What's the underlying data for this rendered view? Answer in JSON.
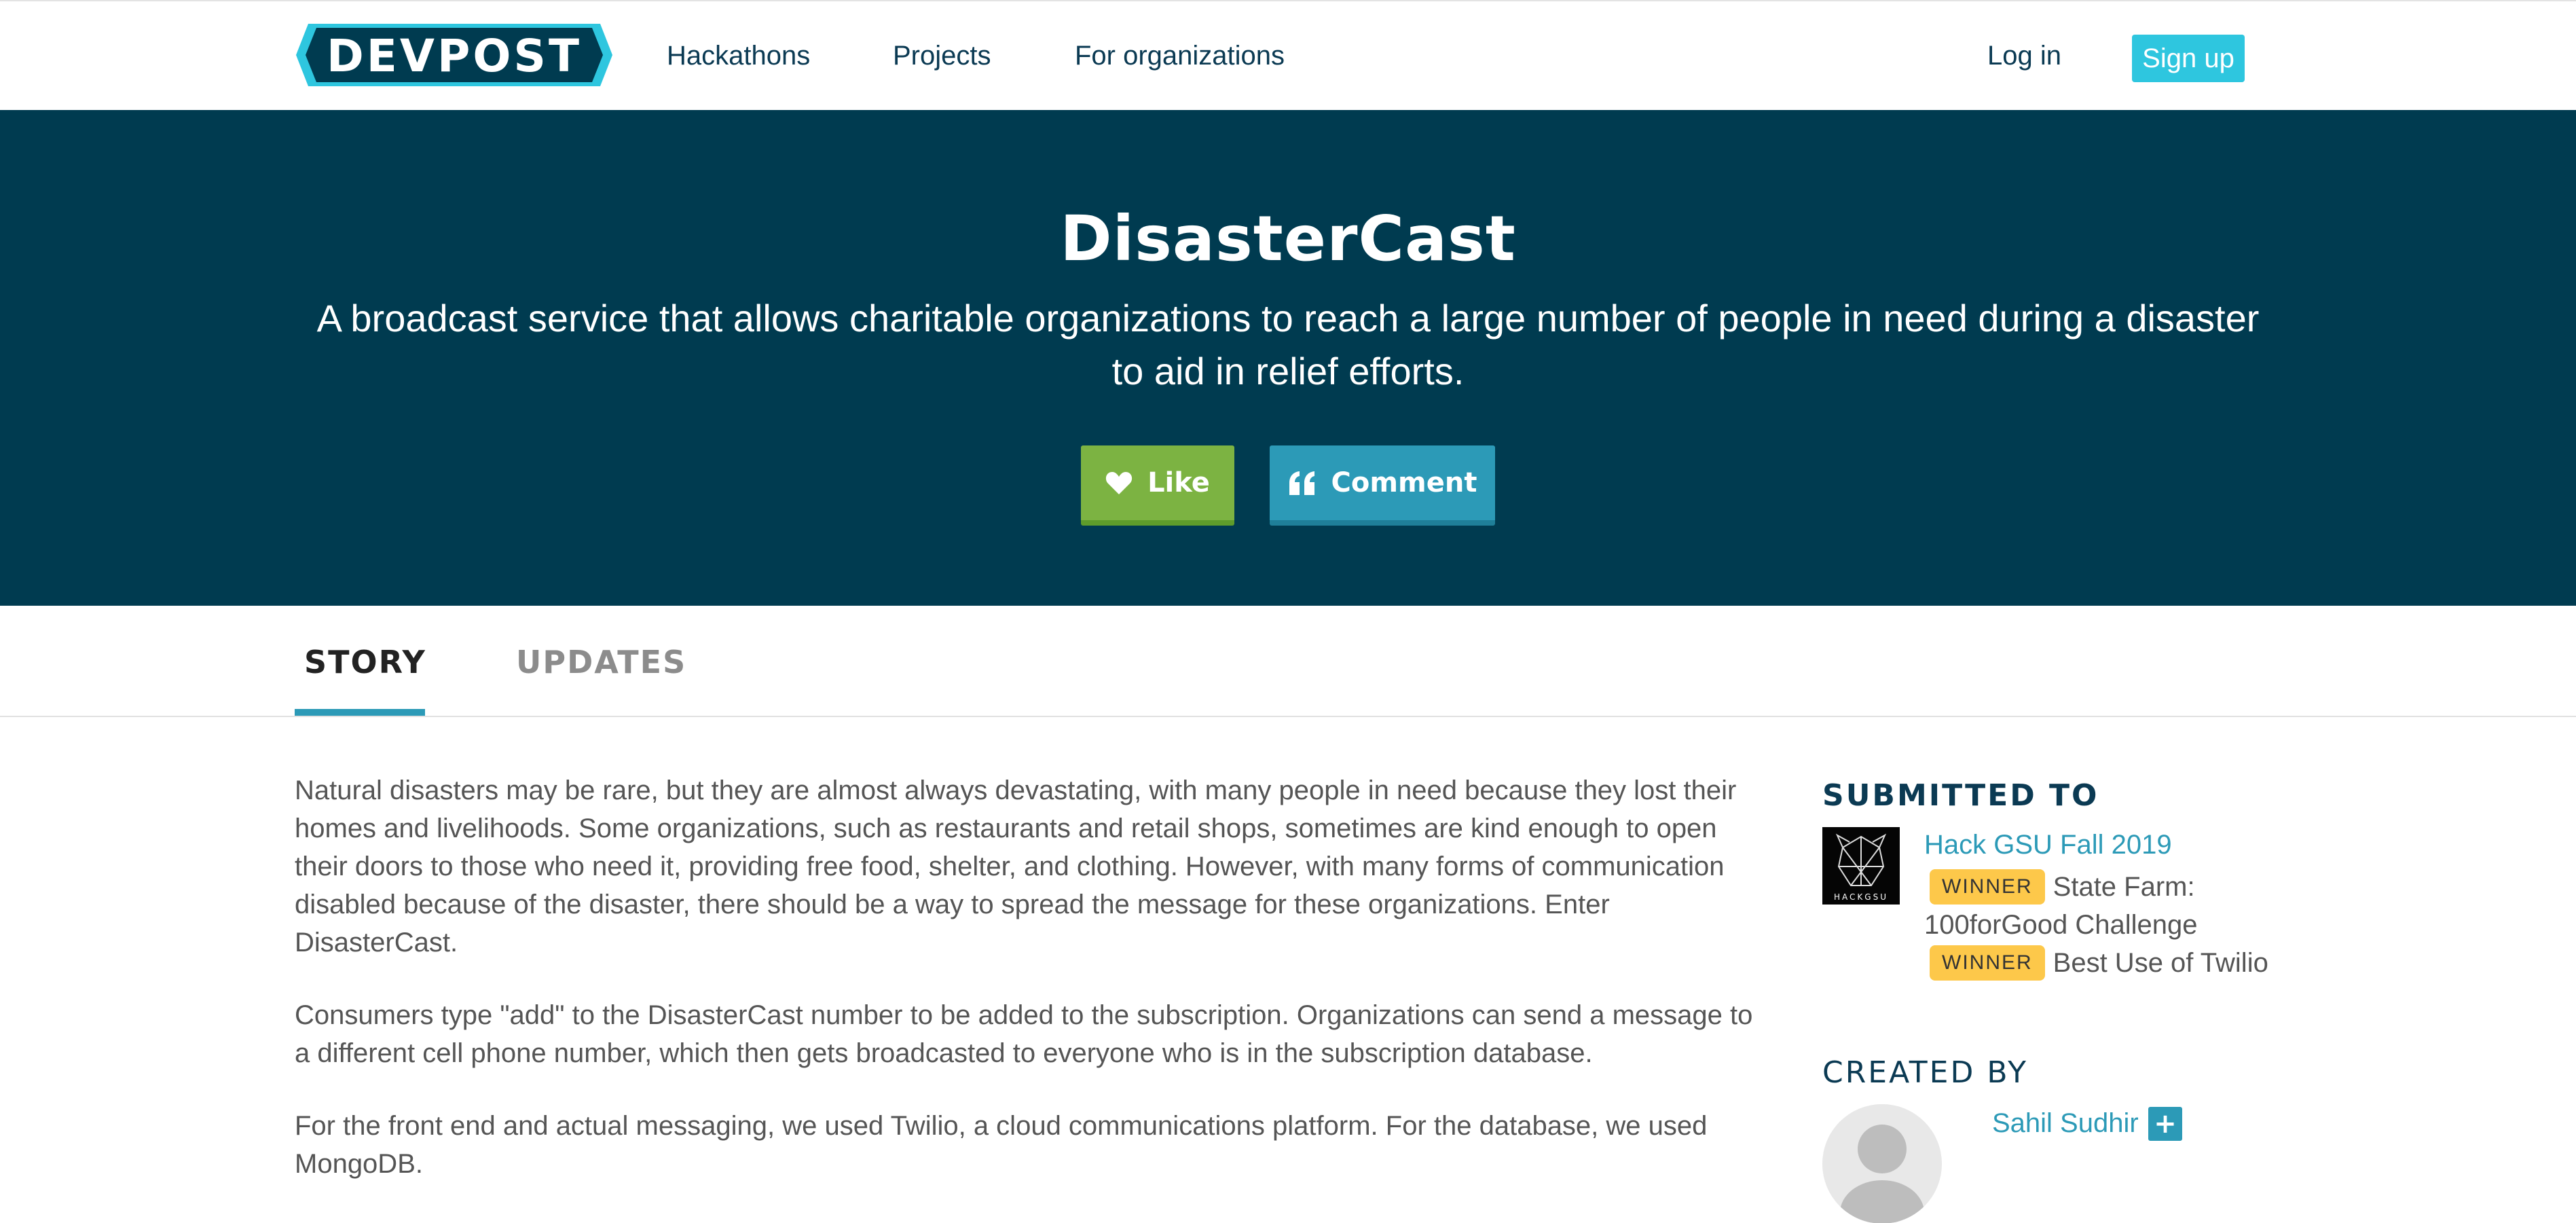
{
  "nav": {
    "logo_text": "DEVPOST",
    "links": [
      "Hackathons",
      "Projects",
      "For organizations"
    ],
    "login": "Log in",
    "signup": "Sign up"
  },
  "hero": {
    "title": "DisasterCast",
    "tagline": "A broadcast service that allows charitable organizations to reach a large number of people in need during a disaster to aid in relief efforts.",
    "like_label": "Like",
    "comment_label": "Comment"
  },
  "tabs": [
    "STORY",
    "UPDATES"
  ],
  "story": {
    "paragraphs": [
      "Natural disasters may be rare, but they are almost always devastating, with many people in need because they lost their homes and livelihoods. Some organizations, such as restaurants and retail shops, sometimes are kind enough to open their doors to those who need it, providing free food, shelter, and clothing. However, with many forms of communication disabled because of the disaster, there should be a way to spread the message for these organizations. Enter DisasterCast.",
      "Consumers type \"add\" to the DisasterCast number to be added to the subscription. Organizations can send a message to a different cell phone number, which then gets broadcasted to everyone who is in the subscription database.",
      "For the front end and actual messaging, we used Twilio, a cloud communications platform. For the database, we used MongoDB."
    ]
  },
  "sidebar": {
    "submitted_heading": "SUBMITTED TO",
    "hackathon": "Hack GSU Fall 2019",
    "hackathon_logo_text": "HACKGSU",
    "prizes": [
      {
        "badge": "WINNER",
        "name": "State Farm: 100forGood Challenge"
      },
      {
        "badge": "WINNER",
        "name": "Best Use of Twilio"
      }
    ],
    "created_heading": "CREATED BY",
    "creator": "Sahil Sudhir",
    "plus": "+"
  },
  "colors": {
    "brand_dark": "#003b50",
    "accent": "#2c9ab7",
    "signup": "#2ec6df",
    "like": "#7cb342",
    "badge": "#fdc84a"
  }
}
